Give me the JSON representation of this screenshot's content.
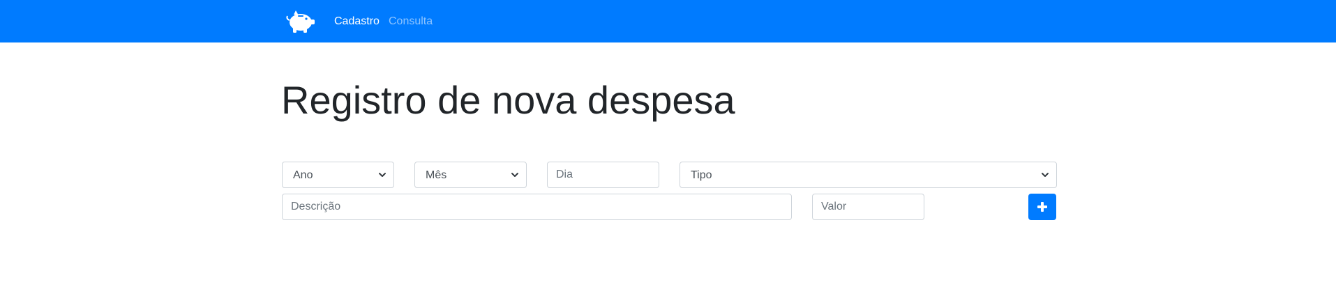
{
  "navbar": {
    "brand_icon": "piggy-bank-icon",
    "links": [
      {
        "label": "Cadastro",
        "active": true
      },
      {
        "label": "Consulta",
        "active": false
      }
    ],
    "background_color": "#007bff"
  },
  "main": {
    "title": "Registro de nova despesa",
    "form": {
      "ano": {
        "selected": "Ano"
      },
      "mes": {
        "selected": "Mês"
      },
      "dia": {
        "placeholder": "Dia",
        "value": ""
      },
      "tipo": {
        "selected": "Tipo"
      },
      "descricao": {
        "placeholder": "Descrição",
        "value": ""
      },
      "valor": {
        "placeholder": "Valor",
        "value": ""
      },
      "add_button_icon": "plus-icon"
    }
  },
  "colors": {
    "primary": "#007bff",
    "border": "#ced4da",
    "text": "#212529",
    "placeholder": "#6c757d"
  }
}
